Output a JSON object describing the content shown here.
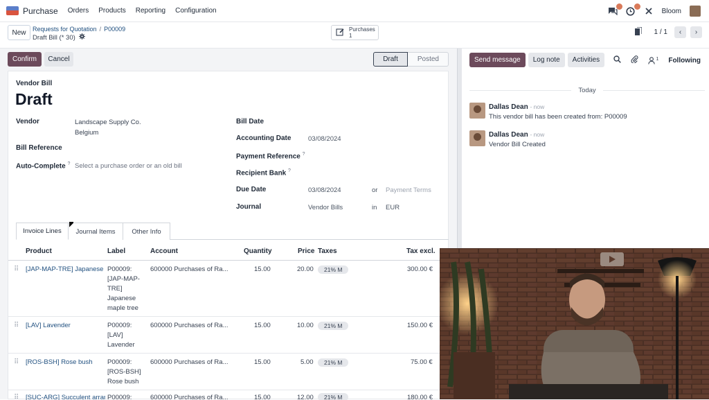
{
  "topbar": {
    "app_name": "Purchase",
    "menu": [
      "Orders",
      "Products",
      "Reporting",
      "Configuration"
    ],
    "company": "Bloom"
  },
  "control": {
    "new_label": "New",
    "breadcrumb": [
      "Requests for Quotation",
      "P00009"
    ],
    "record_name": "Draft Bill (* 30)",
    "smart_button": {
      "label": "Purchases",
      "count": "1"
    },
    "pager": "1 / 1"
  },
  "status": {
    "confirm": "Confirm",
    "cancel": "Cancel",
    "stages": [
      "Draft",
      "Posted"
    ]
  },
  "form": {
    "doc_type": "Vendor Bill",
    "doc_name": "Draft",
    "vendor_label": "Vendor",
    "vendor_name": "Landscape Supply Co.",
    "vendor_country": "Belgium",
    "bill_reference_label": "Bill Reference",
    "auto_complete_label": "Auto-Complete",
    "auto_complete_placeholder": "Select a purchase order or an old bill",
    "bill_date_label": "Bill Date",
    "accounting_date_label": "Accounting Date",
    "accounting_date": "03/08/2024",
    "payment_reference_label": "Payment Reference",
    "recipient_bank_label": "Recipient Bank",
    "due_date_label": "Due Date",
    "due_date": "03/08/2024",
    "or": "or",
    "payment_terms_placeholder": "Payment Terms",
    "journal_label": "Journal",
    "journal": "Vendor Bills",
    "in": "in",
    "currency": "EUR",
    "help": "?"
  },
  "tabs": [
    "Invoice Lines",
    "Journal Items",
    "Other Info"
  ],
  "table": {
    "headers": [
      "Product",
      "Label",
      "Account",
      "Quantity",
      "Price",
      "Taxes",
      "Tax excl."
    ],
    "rows": [
      {
        "product": "[JAP-MAP-TRE] Japanese m",
        "label": [
          "P00009:",
          "[JAP-MAP-",
          "TRE]",
          "Japanese",
          "maple tree"
        ],
        "account": "600000 Purchases of Ra...",
        "qty": "15.00",
        "price": "20.00",
        "tax": "21% M",
        "subtotal": "300.00 €"
      },
      {
        "product": "[LAV] Lavender",
        "label": [
          "P00009:",
          "[LAV]",
          "Lavender"
        ],
        "account": "600000 Purchases of Ra...",
        "qty": "15.00",
        "price": "10.00",
        "tax": "21% M",
        "subtotal": "150.00 €"
      },
      {
        "product": "[ROS-BSH] Rose bush",
        "label": [
          "P00009:",
          "[ROS-BSH]",
          "Rose bush"
        ],
        "account": "600000 Purchases of Ra...",
        "qty": "15.00",
        "price": "5.00",
        "tax": "21% M",
        "subtotal": "75.00 €"
      },
      {
        "product": "[SUC-ARG] Succulent arranc",
        "label": [
          "P00009:"
        ],
        "account": "600000 Purchases of Ra...",
        "qty": "15.00",
        "price": "12.00",
        "tax": "21% M",
        "subtotal": "180.00 €"
      }
    ]
  },
  "chatter": {
    "send_message": "Send message",
    "log_note": "Log note",
    "activities": "Activities",
    "followers_count": "1",
    "following": "Following",
    "today": "Today",
    "messages": [
      {
        "author": "Dallas Dean",
        "time": "- now",
        "body": "This vendor bill has been created from: P00009"
      },
      {
        "author": "Dallas Dean",
        "time": "- now",
        "body": "Vendor Bill Created"
      }
    ]
  },
  "colors": {
    "primary": "#6c4a5b",
    "link": "#1f4f7f"
  }
}
